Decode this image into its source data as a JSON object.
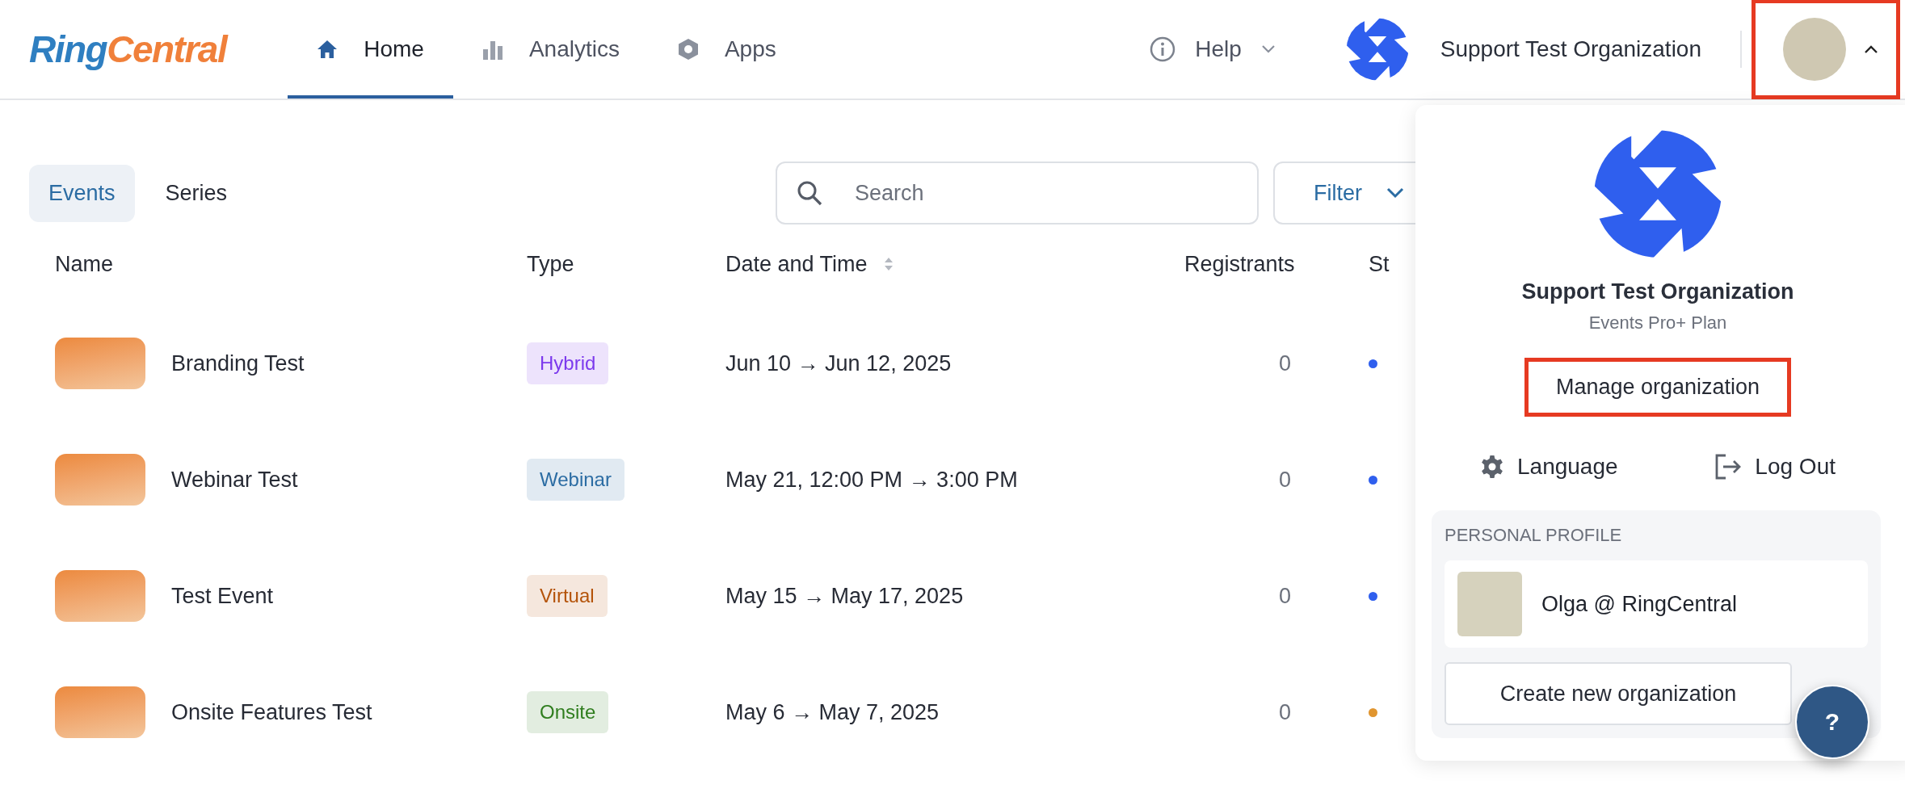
{
  "logo": {
    "first": "Ring",
    "second": "Central"
  },
  "nav": [
    {
      "label": "Home",
      "selected": true
    },
    {
      "label": "Analytics",
      "selected": false
    },
    {
      "label": "Apps",
      "selected": false
    }
  ],
  "help": {
    "label": "Help"
  },
  "organization": {
    "name": "Support Test Organization"
  },
  "account_button": {
    "expanded": true,
    "highlighted": true
  },
  "view_tabs": [
    {
      "label": "Events",
      "selected": true
    },
    {
      "label": "Series",
      "selected": false
    }
  ],
  "search": {
    "placeholder": "Search"
  },
  "filter": {
    "label": "Filter"
  },
  "table": {
    "columns": [
      "Name",
      "Type",
      "Date and Time",
      "Registrants",
      "St"
    ],
    "rows": [
      {
        "name": "Branding Test",
        "type": {
          "label": "Hybrid",
          "color": "#7c3aed"
        },
        "date": "Jun 10 → Jun 12, 2025",
        "registrants": "0",
        "status": {
          "color": "#2f5fee"
        }
      },
      {
        "name": "Webinar Test",
        "type": {
          "label": "Webinar",
          "color": "#2b6ca3"
        },
        "date": "May 21, 12:00 PM → 3:00 PM",
        "registrants": "0",
        "status": {
          "color": "#2f5fee"
        }
      },
      {
        "name": "Test Event",
        "type": {
          "label": "Virtual",
          "color": "#b45309"
        },
        "date": "May 15 → May 17, 2025",
        "registrants": "0",
        "status": {
          "color": "#2f5fee"
        }
      },
      {
        "name": "Onsite Features Test",
        "type": {
          "label": "Onsite",
          "color": "#2f7d1e"
        },
        "date": "May 6 → May 7, 2025",
        "registrants": "0",
        "status": {
          "color": "#e0952f"
        }
      }
    ]
  },
  "menu": {
    "org_name": "Support Test Organization",
    "plan": "Events Pro+ Plan",
    "manage": {
      "label": "Manage organization",
      "highlighted": true
    },
    "actions": [
      {
        "label": "Language"
      },
      {
        "label": "Log Out"
      }
    ],
    "profile_heading": "PERSONAL PROFILE",
    "profile_name": "Olga @ RingCentral",
    "create": "Create new organization"
  },
  "help_fab": {
    "label": "?"
  }
}
